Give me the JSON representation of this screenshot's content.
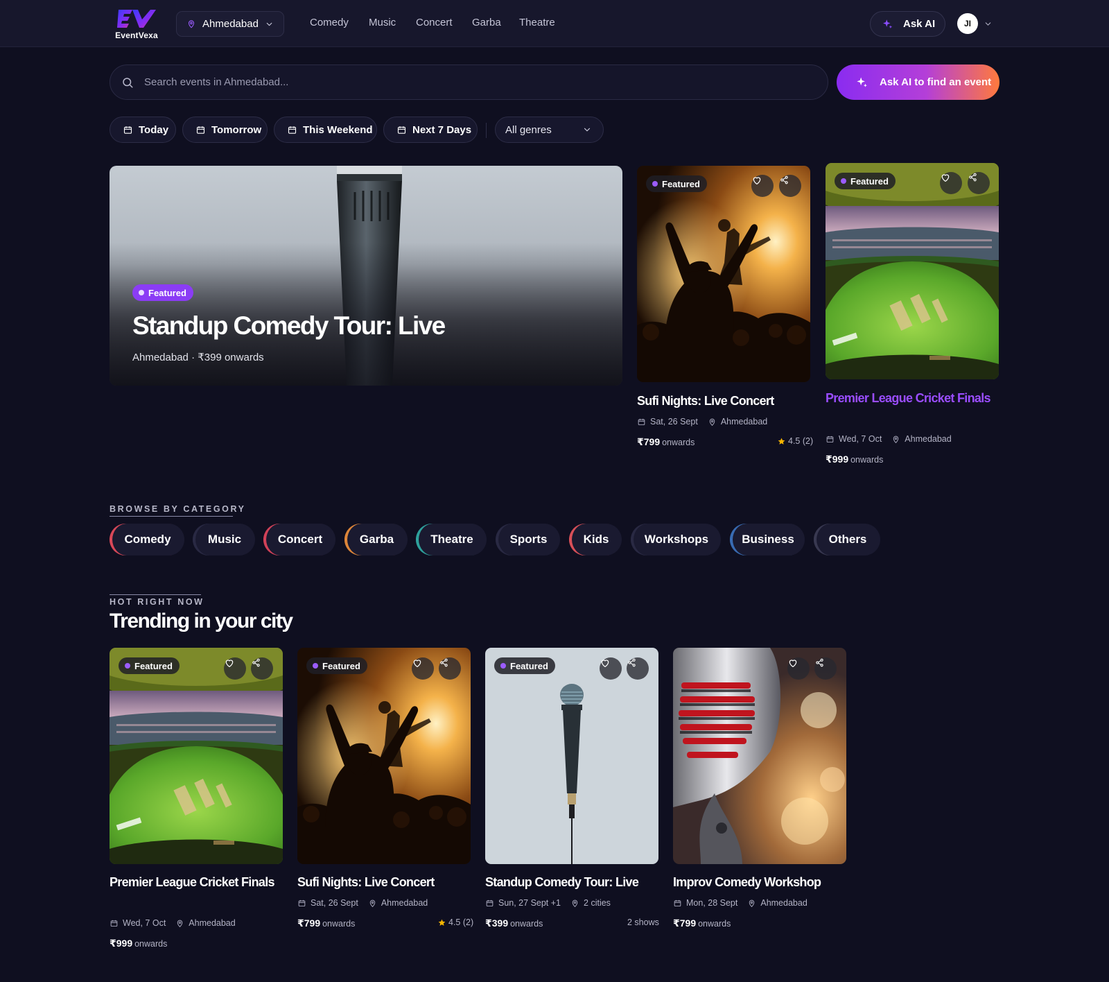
{
  "header": {
    "logo_text": "EventVexa",
    "city": "Ahmedabad",
    "nav": [
      "Comedy",
      "Music",
      "Concert",
      "Garba",
      "Theatre"
    ],
    "ask_ai": "Ask AI",
    "avatar_initials": "JI"
  },
  "search": {
    "placeholder": "Search events in Ahmedabad...",
    "ask_ai_button": "Ask AI to find an event"
  },
  "filters": {
    "chips": [
      "Today",
      "Tomorrow",
      "This Weekend",
      "Next 7 Days"
    ],
    "genre": "All genres"
  },
  "hero": {
    "badge": "Featured",
    "title": "Standup Comedy Tour: Live",
    "subtitle": "Ahmedabad · ₹399 onwards"
  },
  "featured_cards": [
    {
      "badge": "Featured",
      "title": "Sufi Nights: Live Concert",
      "date": "Sat, 26 Sept",
      "location": "Ahmedabad",
      "price": "₹799",
      "price_suffix": "onwards",
      "rating": "4.5 (2)"
    },
    {
      "badge": "Featured",
      "title": "Premier League Cricket Finals",
      "date": "Wed, 7 Oct",
      "location": "Ahmedabad",
      "price": "₹999",
      "price_suffix": "onwards"
    }
  ],
  "categories": {
    "label": "BROWSE BY CATEGORY",
    "items": [
      {
        "label": "Comedy",
        "color": "#e04a5a"
      },
      {
        "label": "Music",
        "color": "#2a2a44"
      },
      {
        "label": "Concert",
        "color": "#d9435a"
      },
      {
        "label": "Garba",
        "color": "#e58a3a"
      },
      {
        "label": "Theatre",
        "color": "#2fa6a0"
      },
      {
        "label": "Sports",
        "color": "#2a2a44"
      },
      {
        "label": "Kids",
        "color": "#e0525a"
      },
      {
        "label": "Workshops",
        "color": "#2a2a44"
      },
      {
        "label": "Business",
        "color": "#3a6fb8"
      },
      {
        "label": "Others",
        "color": "#3a3a52"
      }
    ]
  },
  "trending": {
    "label": "HOT RIGHT NOW",
    "title": "Trending in your city",
    "cards": [
      {
        "badge": "Featured",
        "title": "Premier League Cricket Finals",
        "date": "Wed, 7 Oct",
        "location": "Ahmedabad",
        "price": "₹999",
        "price_suffix": "onwards"
      },
      {
        "badge": "Featured",
        "title": "Sufi Nights: Live Concert",
        "date": "Sat, 26 Sept",
        "location": "Ahmedabad",
        "price": "₹799",
        "price_suffix": "onwards",
        "rating": "4.5 (2)"
      },
      {
        "badge": "Featured",
        "title": "Standup Comedy Tour: Live",
        "date": "Sun, 27 Sept +1",
        "location": "2 cities",
        "price": "₹399",
        "price_suffix": "onwards",
        "shows": "2 shows"
      },
      {
        "title": "Improv Comedy Workshop",
        "date": "Mon, 28 Sept",
        "location": "Ahmedabad",
        "price": "₹799",
        "price_suffix": "onwards"
      }
    ]
  },
  "colors": {
    "background": "#0f0f20",
    "accent": "#8b3cf5",
    "accent_gradient_end": "#ff7a3c",
    "title_highlight": "#9a4dff",
    "star": "#f5b400"
  }
}
